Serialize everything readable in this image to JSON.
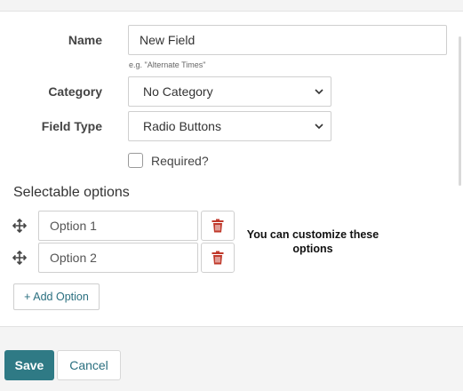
{
  "form": {
    "name": {
      "label": "Name",
      "value": "New Field",
      "hint": "e.g. \"Alternate Times\""
    },
    "category": {
      "label": "Category",
      "selected": "No Category"
    },
    "field_type": {
      "label": "Field Type",
      "selected": "Radio Buttons"
    },
    "required": {
      "label": "Required?",
      "checked": false
    }
  },
  "options_section": {
    "title": "Selectable options",
    "options": [
      {
        "value": "Option 1"
      },
      {
        "value": "Option 2"
      }
    ],
    "add_label": "+ Add Option",
    "note": "You can customize these options"
  },
  "footer": {
    "save_label": "Save",
    "cancel_label": "Cancel"
  },
  "colors": {
    "primary": "#2f7a85",
    "link": "#2a6f7f",
    "delete": "#c0392b"
  },
  "icons": {
    "drag": "drag-handle-icon",
    "delete": "trash-icon",
    "dropdown": "chevron-down-icon"
  }
}
